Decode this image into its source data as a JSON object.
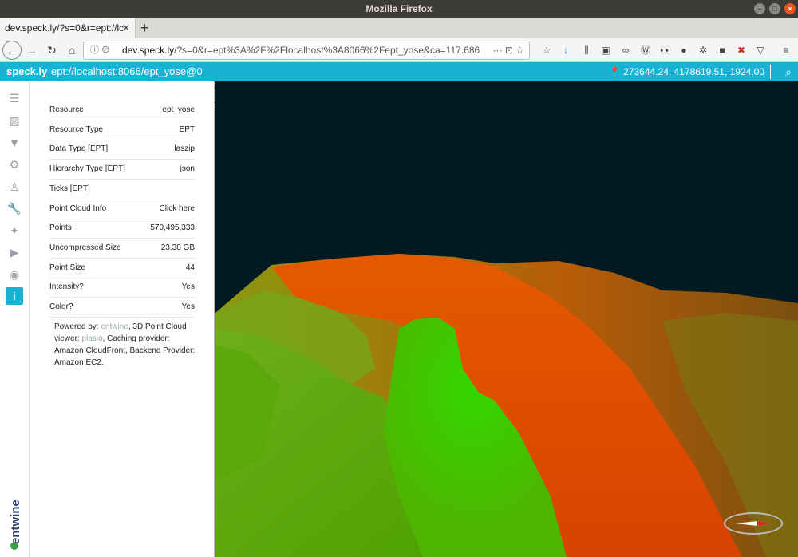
{
  "window": {
    "title": "Mozilla Firefox"
  },
  "tab": {
    "label": "dev.speck.ly/?s=0&r=ept://lc"
  },
  "urlbar": {
    "host": "dev.speck.ly",
    "path": "/?s=0&r=ept%3A%2F%2Flocalhost%3A8066%2Fept_yose&ca=117.686"
  },
  "appbar": {
    "logo": "speck.ly",
    "resource": "ept://localhost:8066/ept_yose@0",
    "coords": "273644.24, 4178619.51, 1924.00"
  },
  "info": {
    "rows": [
      {
        "label": "Resource",
        "value": "ept_yose"
      },
      {
        "label": "Resource Type",
        "value": "EPT"
      },
      {
        "label": "Data Type [EPT]",
        "value": "laszip"
      },
      {
        "label": "Hierarchy Type [EPT]",
        "value": "json"
      },
      {
        "label": "Ticks [EPT]",
        "value": ""
      },
      {
        "label": "Point Cloud Info",
        "value": "Click here"
      },
      {
        "label": "Points",
        "value": "570,495,333"
      },
      {
        "label": "Uncompressed Size",
        "value": "23.38 GB"
      },
      {
        "label": "Point Size",
        "value": "44"
      },
      {
        "label": "Intensity?",
        "value": "Yes"
      },
      {
        "label": "Color?",
        "value": "Yes"
      }
    ],
    "credit": {
      "powered_by": "Powered by: ",
      "entwine": "entwine",
      "viewer_pre": ", 3D Point Cloud viewer: ",
      "plasio": "plasio",
      "rest": ", Caching provider: Amazon CloudFront, Backend Provider: Amazon EC2."
    }
  },
  "brand": {
    "name": "entwine"
  },
  "colors": {
    "accent": "#18b3d4",
    "viewport_bg": "#041a22",
    "terrain_green": "#4caf00",
    "terrain_red": "#e04000"
  }
}
